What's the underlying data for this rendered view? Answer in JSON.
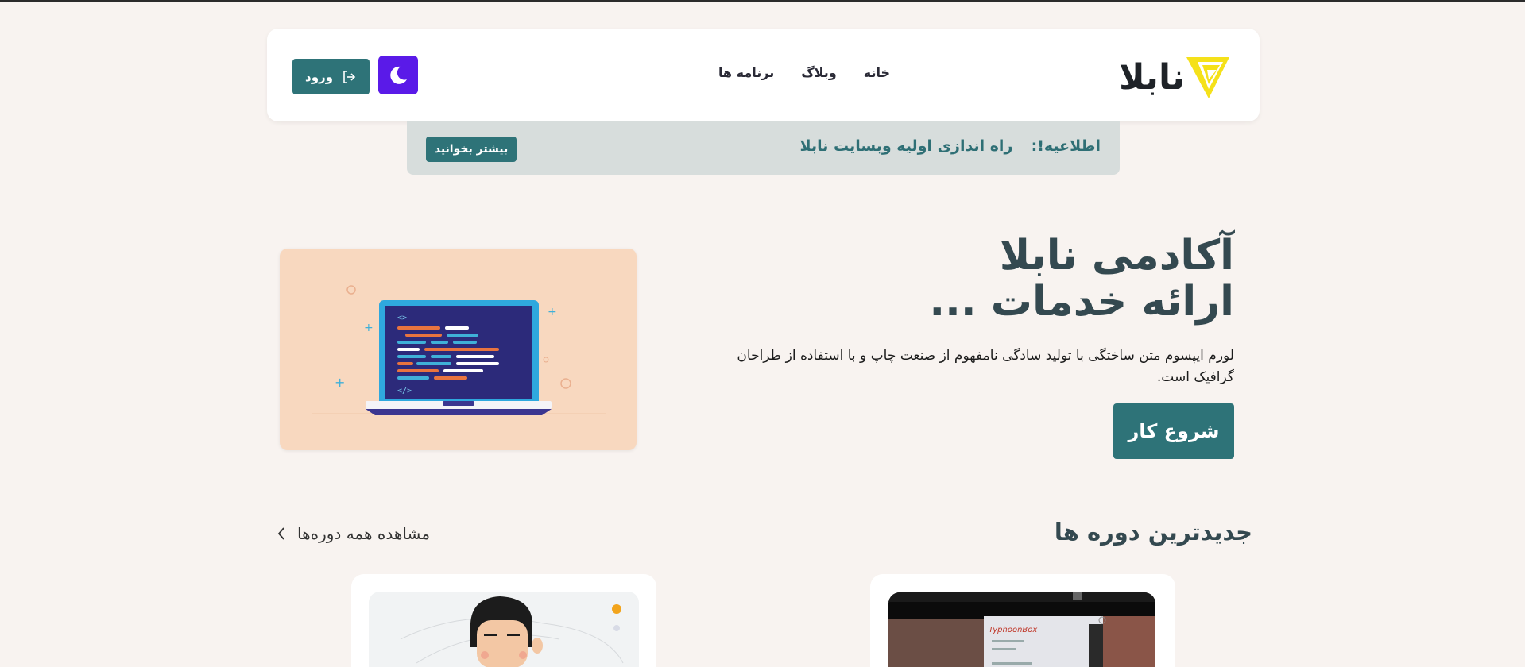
{
  "brand": {
    "name": "نابلا",
    "logo_color": "#f5e11a"
  },
  "nav": {
    "items": [
      "خانه",
      "وبلاگ",
      "برنامه ها"
    ]
  },
  "header": {
    "login_label": "ورود",
    "theme_icon": "moon-icon",
    "login_icon": "login-icon"
  },
  "notice": {
    "label": "اطلاعیه!:",
    "text": "راه اندازی اولیه وبسایت نابلا",
    "button": "بیشتر بخوانید"
  },
  "hero": {
    "title_line1": "آکادمی نابلا",
    "title_line2": "ارائه خدمات ...",
    "description": "لورم ایپسوم متن ساختگی با تولید سادگی نامفهوم از صنعت چاپ و با استفاده از طراحان گرافیک است.",
    "cta": "شروع کار"
  },
  "courses": {
    "title": "جدیدترین دوره ها",
    "see_all": "مشاهده همه دوره‌ها",
    "card_thumbnail_text": "TyphoonBox"
  },
  "colors": {
    "primary": "#2e7378",
    "accent": "#5a1ae8",
    "background": "#f8f3f0",
    "heading": "#344950"
  }
}
